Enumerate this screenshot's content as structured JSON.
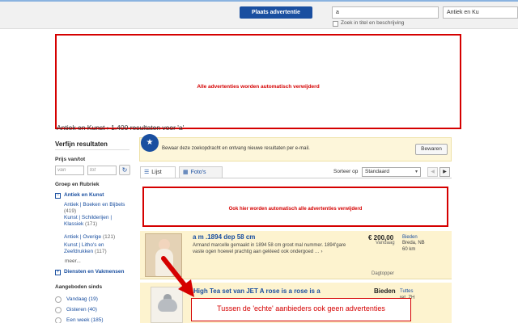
{
  "header": {
    "place_ad_label": "Plaats advertentie",
    "search_value": "a",
    "category_select": "Antiek en Ku",
    "search_in_title_label": "Zoek in titel en beschrijving"
  },
  "annotations": {
    "top_box_text": "Alle advertenties worden automatisch verwijderd",
    "middle_box_text": "Ook hier worden automatisch alle advertenties verwijderd",
    "bottom_box_text": "Tussen de 'echte' aanbieders ook geen advertenties"
  },
  "results": {
    "heading": "Antiek en Kunst  ›  1.400 resultaten voor 'a'"
  },
  "sidebar": {
    "title": "Verfijn resultaten",
    "price_label": "Prijs van/tot",
    "price_from_placeholder": "van",
    "price_to_placeholder": "tot",
    "refresh_icon": "↻",
    "group_label": "Groep en Rubriek",
    "main_category": "Antiek en Kunst",
    "subcategories": [
      {
        "label": "Antiek | Boeken en Bijbels",
        "count": "(419)"
      },
      {
        "label": "Kunst | Schilderijen | Klassiek",
        "count": "(171)"
      },
      {
        "label": "Antiek | Overige",
        "count": "(121)"
      },
      {
        "label": "Kunst | Litho's en Zeefdrukken",
        "count": "(117)"
      }
    ],
    "more_label": "meer...",
    "other_category": "Diensten en Vakmensen",
    "offered_since_label": "Aangeboden sinds",
    "offered_since_options": [
      {
        "label": "Vandaag",
        "count": "(19)"
      },
      {
        "label": "Gisteren",
        "count": "(40)"
      },
      {
        "label": "Een week",
        "count": "(185)"
      }
    ]
  },
  "save_search": {
    "badge": "★",
    "text": "Bewaar deze zoekopdracht en ontvang nieuwe resultaten per e-mail.",
    "button_label": "Bewaren"
  },
  "tabs": {
    "list_label": "Lijst",
    "list_icon": "☰",
    "photos_label": "Foto's",
    "photos_icon": "▦"
  },
  "sort": {
    "label": "Sorteer op",
    "value": "Standaard",
    "caret": "▾",
    "prev": "◀",
    "next": "▶"
  },
  "listings": [
    {
      "title": "a m .1894 dep 58 cm",
      "description": "Armand marcelle gemaakt in 1894 58 cm groot mal nummer. 1894'gare vaste ogen hoewel prachtig aan gekleed ook ondergoed … ›",
      "price": "€ 200,00",
      "bid_label": "Bieden",
      "date": "Vandaag",
      "city": "Breda, NB",
      "distance": "60 km",
      "badge": "Dagtopper"
    },
    {
      "title": "High Tea set van JET A rose is a rose is a",
      "price": "Bieden",
      "city_line1": "Tuttes",
      "city_line2": "ret, ZH"
    }
  ],
  "colors": {
    "annotation_red": "#d50000",
    "link_blue": "#1a4fa0",
    "highlight_yellow": "#fdf3cf"
  }
}
